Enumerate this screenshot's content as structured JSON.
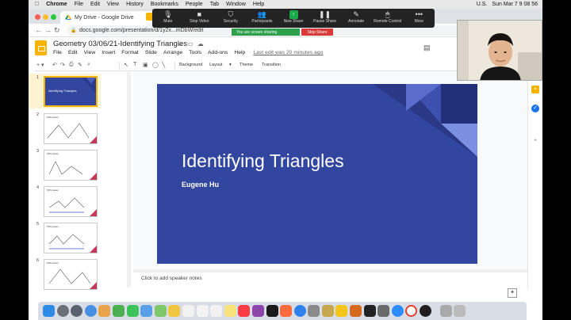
{
  "menubar": {
    "items": [
      "Chrome",
      "File",
      "Edit",
      "View",
      "History",
      "Bookmarks",
      "People",
      "Tab",
      "Window",
      "Help"
    ],
    "right": [
      "U.S.",
      "Sun Mar 7  9 08 56"
    ]
  },
  "browser": {
    "tab_title": "My Drive - Google Drive",
    "url": "docs.google.com/presentation/d/1y2x...mDbW/edit"
  },
  "zoom": {
    "buttons": [
      {
        "icon": "microphone-icon",
        "label": "Mute"
      },
      {
        "icon": "video-camera-icon",
        "label": "Stop Video"
      },
      {
        "icon": "shield-icon",
        "label": "Security"
      },
      {
        "icon": "participants-icon",
        "label": "Participants"
      },
      {
        "icon": "new-share-icon",
        "label": "New Share"
      },
      {
        "icon": "pause-icon",
        "label": "Pause Share"
      },
      {
        "icon": "annotate-icon",
        "label": "Annotate"
      },
      {
        "icon": "remote-control-icon",
        "label": "Remote Control"
      },
      {
        "icon": "more-icon",
        "label": "More"
      }
    ],
    "sharing_text": "You are screen sharing",
    "stop_share": "Stop Share"
  },
  "doc": {
    "title": "Geometry 03/06/21-Identifying Triangles",
    "menus": [
      "File",
      "Edit",
      "View",
      "Insert",
      "Format",
      "Slide",
      "Arrange",
      "Tools",
      "Add-ons",
      "Help"
    ],
    "last_edit": "Last edit was 20 minutes ago"
  },
  "toolbar": {
    "background": "Background",
    "layout": "Layout",
    "theme": "Theme",
    "transition": "Transition"
  },
  "slides": [
    {
      "num": "1",
      "label": "Identifying Triangles"
    },
    {
      "num": "2",
      "label": "SSS cases"
    },
    {
      "num": "3",
      "label": "SSS cases"
    },
    {
      "num": "4",
      "label": "SSS cases"
    },
    {
      "num": "5",
      "label": "SSS cases"
    },
    {
      "num": "6",
      "label": "SSS cases"
    }
  ],
  "slide": {
    "title": "Identifying Triangles",
    "subtitle": "Eugene Hu",
    "bg_color": "#33469f"
  },
  "notes_placeholder": "Click to add speaker notes"
}
